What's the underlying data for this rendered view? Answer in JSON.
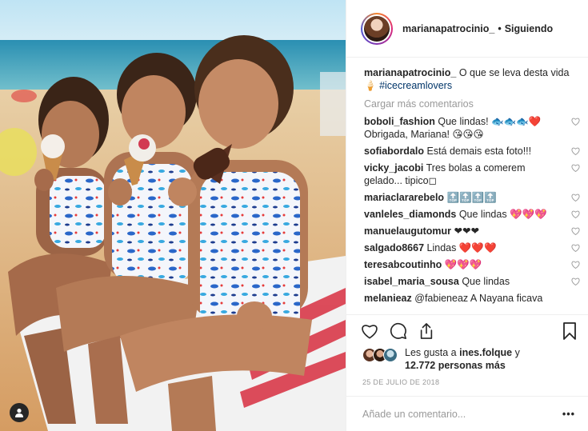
{
  "header": {
    "username": "marianapatrocinio_",
    "separator": "•",
    "follow_status": "Siguiendo"
  },
  "caption": {
    "username": "marianapatrocinio_",
    "text": "O que se leva desta vida 🍦",
    "hashtag": "#icecreamlovers"
  },
  "load_more": "Cargar más comentarios",
  "comments": [
    {
      "user": "boboli_fashion",
      "text": "Que lindas! 🐟🐟🐟❤️ Obrigada, Mariana! 😘😘😘"
    },
    {
      "user": "sofiabordalo",
      "text": "Está demais esta foto!!!"
    },
    {
      "user": "vicky_jacobi",
      "text": "Tres bolas a comerem gelado... tipico◻"
    },
    {
      "user": "mariaclararebelo",
      "text": "🔝🔝🔝🔝"
    },
    {
      "user": "vanleles_diamonds",
      "text": "Que lindas 💖💖💖"
    },
    {
      "user": "manuelaugutomur",
      "text": "❤❤❤"
    },
    {
      "user": "salgado8667",
      "text": "Lindas ❤️❤️❤️"
    },
    {
      "user": "teresabcoutinho",
      "text": "💖💖💖"
    },
    {
      "user": "isabel_maria_sousa",
      "text": "Que lindas"
    },
    {
      "user": "melanieaz",
      "text": "@fabieneaz A Nayana ficava"
    }
  ],
  "likes": {
    "prefix": "Les gusta a",
    "user": "ines.folque",
    "conj": "y",
    "count_text": "12.772 personas más"
  },
  "date": "25 DE JULIO DE 2018",
  "add_comment": {
    "placeholder": "Añade un comentario...",
    "more": "•••"
  },
  "icons": [
    "heart-icon",
    "comment-icon",
    "share-icon",
    "bookmark-icon",
    "user-tag-icon"
  ]
}
